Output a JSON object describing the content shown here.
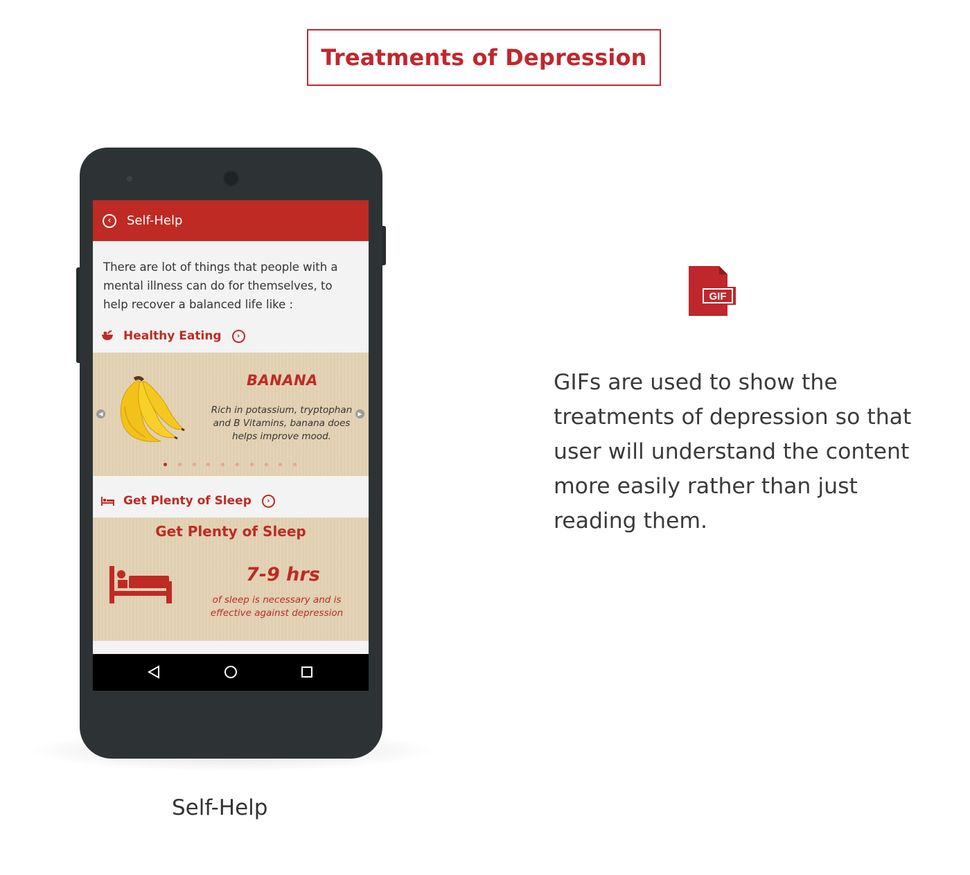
{
  "title": "Treatments of Depression",
  "phone": {
    "appbar_title": "Self-Help",
    "intro": "There are lot of things that people with a mental illness can do for themselves, to help recover a balanced life like :",
    "sections": [
      {
        "label": "Healthy Eating",
        "icon": "bowl-icon",
        "card": {
          "title": "BANANA",
          "description": "Rich in potassium, tryptophan and B Vitamins, banana does helps improve mood.",
          "pages": 10,
          "active_page": 1
        }
      },
      {
        "label": "Get Plenty of Sleep",
        "icon": "bed-icon",
        "card": {
          "title": "Get Plenty of Sleep",
          "hours": "7-9 hrs",
          "description": "of sleep is necessary and is effective against depression"
        }
      }
    ]
  },
  "caption": "Self-Help",
  "gif_label": "GIF",
  "description": "GIFs are used to show the treatments of depression so that user will understand the content more easily rather than just reading them.",
  "colors": {
    "accent": "#bf2a24",
    "card_bg": "#e3d2b3",
    "phone_body": "#2d3334"
  }
}
